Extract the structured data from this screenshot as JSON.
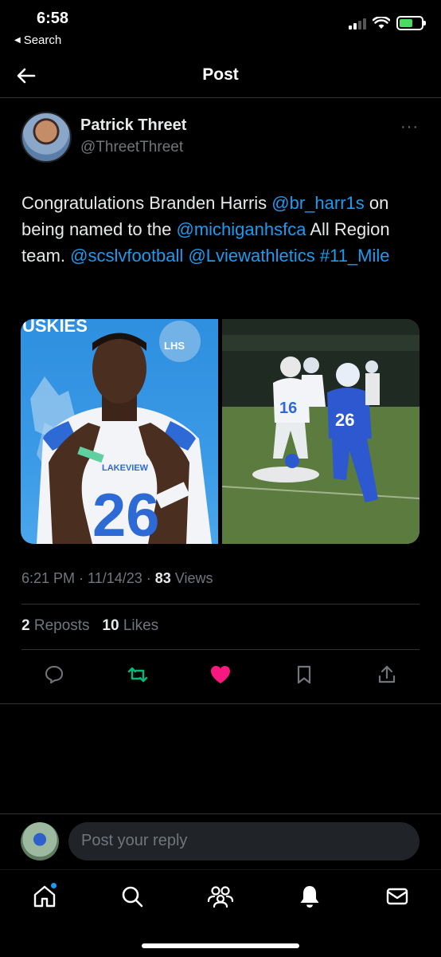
{
  "status": {
    "time": "6:58",
    "back_app": "Search"
  },
  "nav": {
    "title": "Post"
  },
  "author": {
    "name": "Patrick Threet",
    "handle": "@ThreetThreet",
    "more": "···"
  },
  "tweet": {
    "segments": {
      "s1": "Congratulations Branden Harris ",
      "m1": "@br_harr1s",
      "s2": " on being named to the ",
      "m2": "@michiganhsfca",
      "s3": " All Region team. ",
      "m3": "@scslvfootball",
      "s4": " ",
      "m4": "@Lviewathletics",
      "s5": " ",
      "h1": "#11_Mile"
    },
    "images": {
      "left": {
        "banner": "USKIES",
        "badge": "LHS",
        "jersey_text": "LAKEVIEW",
        "jersey_number": "26"
      },
      "right": {
        "player1_number": "16",
        "player2_number": "26"
      }
    }
  },
  "meta": {
    "timestamp": "6:21 PM · 11/14/23 · ",
    "views_count": "83",
    "views_label": " Views"
  },
  "counts": {
    "reposts_count": "2",
    "reposts_label": " Reposts",
    "likes_count": "10",
    "likes_label": " Likes"
  },
  "reply": {
    "placeholder": "Post your reply"
  },
  "colors": {
    "link": "#1d9bf0",
    "repost_active": "#00ba7c",
    "like_active": "#f91880",
    "secondary_text": "#71767b"
  },
  "icons": {
    "back": "arrow-left-icon",
    "reply": "comment-icon",
    "repost": "repost-icon",
    "like": "heart-icon",
    "bookmark": "bookmark-icon",
    "share": "share-icon",
    "home": "home-icon",
    "search": "search-icon",
    "communities": "communities-icon",
    "notifications": "bell-icon",
    "messages": "envelope-icon"
  }
}
